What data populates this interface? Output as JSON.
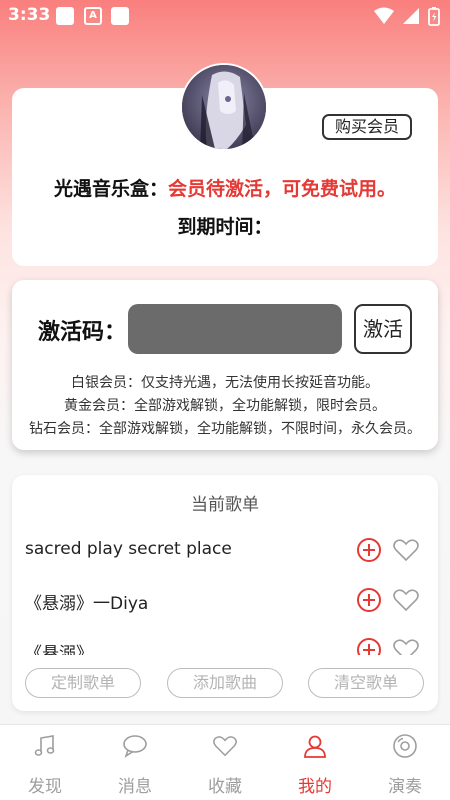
{
  "status_bar": {
    "time": "3:33"
  },
  "profile": {
    "buy_vip_label": "购买会员",
    "app_name": "光遇音乐盒：",
    "vip_status": "会员待激活，可免费试用。",
    "expire_label": "到期时间："
  },
  "activation": {
    "label": "激活码：",
    "input_value": "",
    "button_label": "激活",
    "tiers": [
      "白银会员：仅支持光遇，无法使用长按延音功能。",
      "黄金会员：全部游戏解锁，全功能解锁，限时会员。",
      "钻石会员：全部游戏解锁，全功能解锁，不限时间，永久会员。"
    ]
  },
  "playlist": {
    "title": "当前歌单",
    "songs": [
      {
        "title": "sacred play secret place"
      },
      {
        "title": "《悬溺》一Diya"
      },
      {
        "title": "《悬溺》"
      }
    ],
    "actions": {
      "custom": "定制歌单",
      "add": "添加歌曲",
      "clear": "清空歌单"
    }
  },
  "nav": {
    "items": [
      {
        "label": "发现",
        "icon": "music-note-icon"
      },
      {
        "label": "消息",
        "icon": "chat-bubble-icon"
      },
      {
        "label": "收藏",
        "icon": "heart-icon"
      },
      {
        "label": "我的",
        "icon": "person-icon",
        "active": true
      },
      {
        "label": "演奏",
        "icon": "disc-icon"
      }
    ]
  },
  "colors": {
    "accent": "#e53935",
    "header_gradient_top": "#f97f7d",
    "activation_input": "#6b6b6b"
  }
}
